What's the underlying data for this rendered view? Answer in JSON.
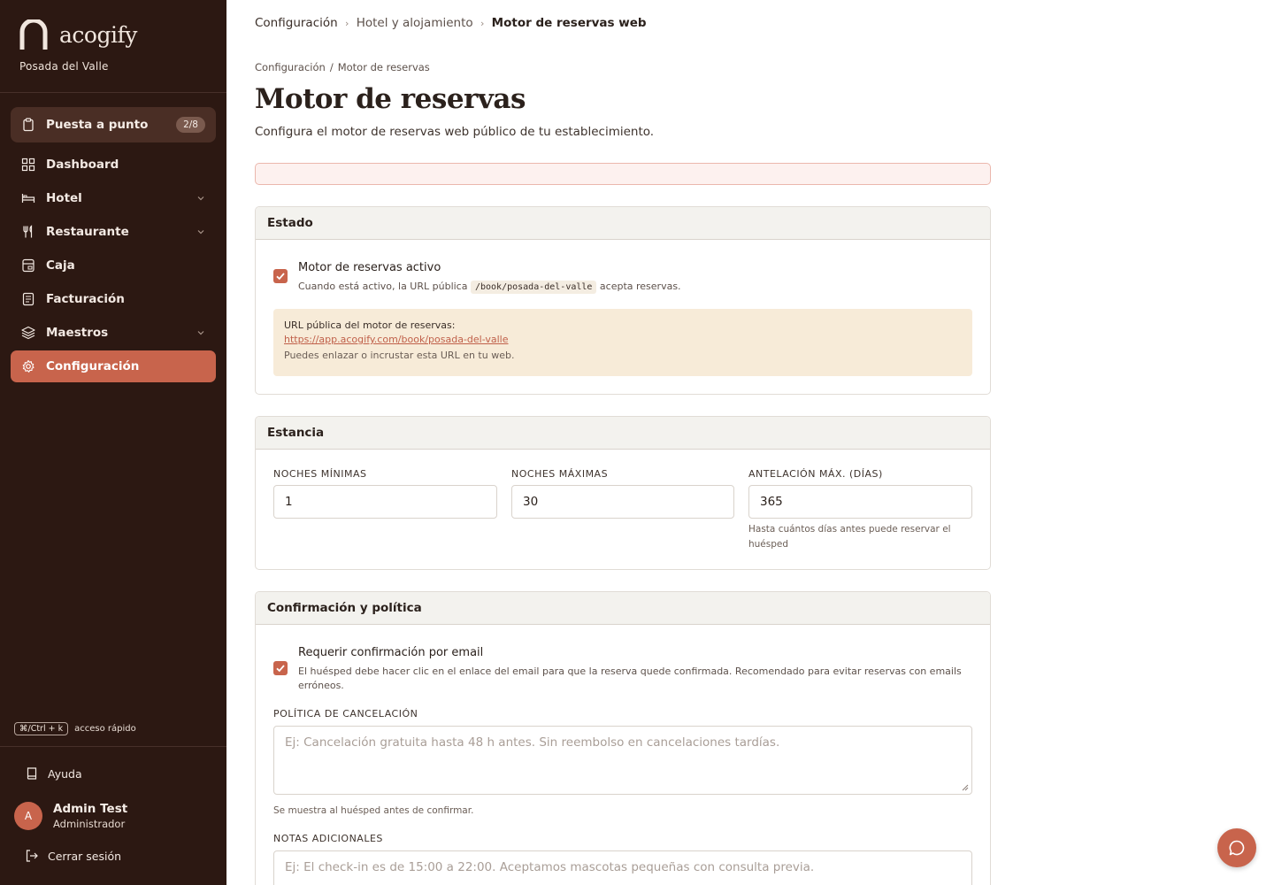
{
  "brand": {
    "name": "acogify",
    "property": "Posada del Valle"
  },
  "setup": {
    "label": "Puesta a punto",
    "badge": "2/8"
  },
  "nav": [
    {
      "label": "Dashboard",
      "icon": "grid-icon"
    },
    {
      "label": "Hotel",
      "icon": "bed-icon",
      "expandable": true
    },
    {
      "label": "Restaurante",
      "icon": "utensils-icon",
      "expandable": true
    },
    {
      "label": "Caja",
      "icon": "cash-register-icon"
    },
    {
      "label": "Facturación",
      "icon": "receipt-icon"
    },
    {
      "label": "Maestros",
      "icon": "layers-icon",
      "expandable": true
    },
    {
      "label": "Configuración",
      "icon": "gear-icon",
      "active": true
    }
  ],
  "shortcut": {
    "keys": "⌘/Ctrl + k",
    "label": "acceso rápido"
  },
  "footer": {
    "help": "Ayuda",
    "user_initial": "A",
    "user_name": "Admin Test",
    "user_role": "Administrador",
    "logout": "Cerrar sesión"
  },
  "topbar": {
    "crumbs": [
      "Configuración",
      "Hotel y alojamiento",
      "Motor de reservas web"
    ]
  },
  "page": {
    "breadcrumb": [
      "Configuración",
      "Motor de reservas"
    ],
    "title": "Motor de reservas",
    "subtitle": "Configura el motor de reservas web público de tu establecimiento."
  },
  "estado": {
    "heading": "Estado",
    "active_label": "Motor de reservas activo",
    "active_checked": true,
    "desc_before": "Cuando está activo, la URL pública",
    "desc_path": "/book/posada-del-valle",
    "desc_after": "acepta reservas.",
    "url_title": "URL pública del motor de reservas:",
    "url": "https://app.acogify.com/book/posada-del-valle",
    "url_hint": "Puedes enlazar o incrustar esta URL en tu web."
  },
  "estancia": {
    "heading": "Estancia",
    "min_label": "NOCHES MÍNIMAS",
    "min_value": "1",
    "max_label": "NOCHES MÁXIMAS",
    "max_value": "30",
    "adv_label": "ANTELACIÓN MÁX. (DÍAS)",
    "adv_value": "365",
    "adv_hint": "Hasta cuántos días antes puede reservar el huésped"
  },
  "confirmacion": {
    "heading": "Confirmación y política",
    "email_label": "Requerir confirmación por email",
    "email_checked": true,
    "email_desc": "El huésped debe hacer clic en el enlace del email para que la reserva quede confirmada. Recomendado para evitar reservas con emails erróneos.",
    "policy_label": "POLÍTICA DE CANCELACIÓN",
    "policy_placeholder": "Ej: Cancelación gratuita hasta 48 h antes. Sin reembolso en cancelaciones tardías.",
    "policy_hint": "Se muestra al huésped antes de confirmar.",
    "notes_label": "NOTAS ADICIONALES",
    "notes_placeholder": "Ej: El check-in es de 15:00 a 22:00. Aceptamos mascotas pequeñas con consulta previa."
  },
  "colors": {
    "sidebar": "#2c1812",
    "accent": "#c8644c",
    "notice": "#f7ebd8"
  }
}
